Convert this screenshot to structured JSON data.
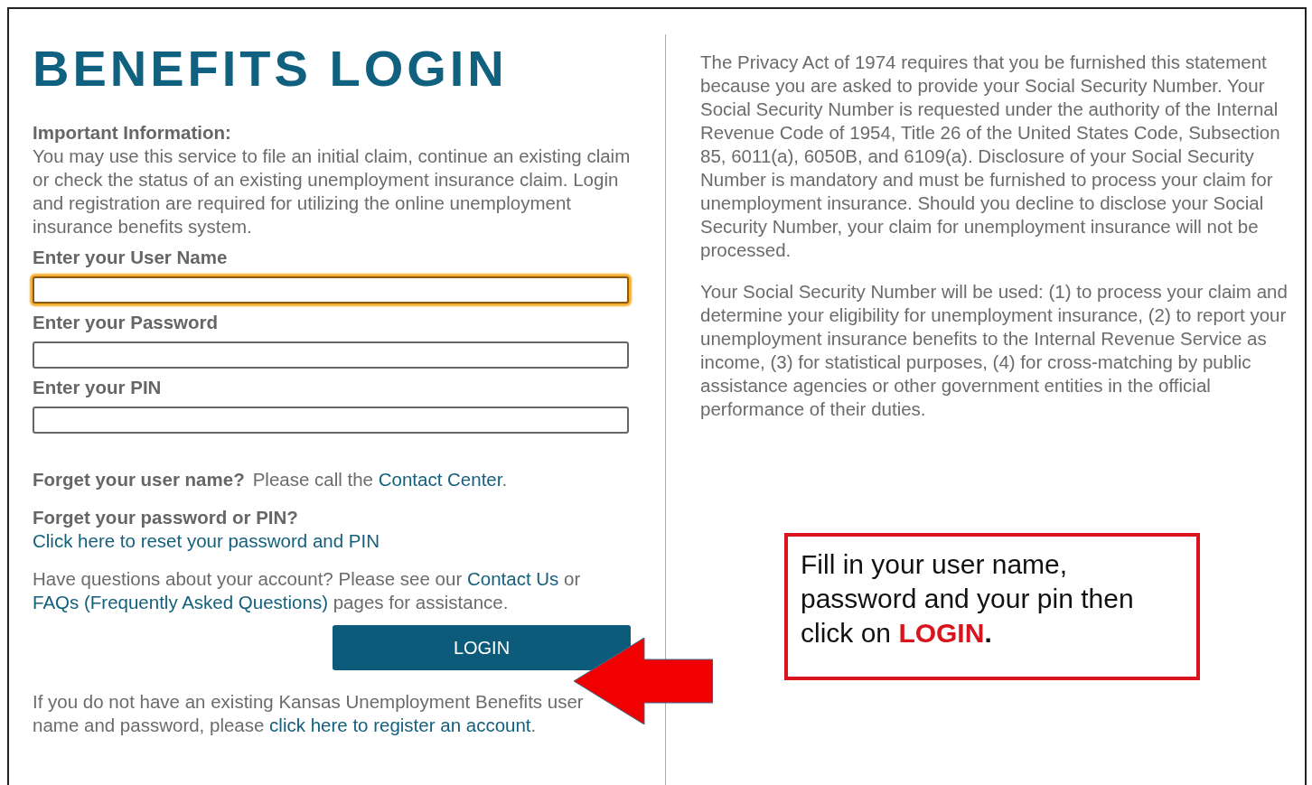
{
  "title": "BENEFITS LOGIN",
  "info": {
    "heading": "Important Information:",
    "text": "You may use this service to file an initial claim, continue an existing claim or check the status of an existing unemployment insurance claim. Login and registration are required for utilizing the online unemployment insurance benefits system."
  },
  "fields": [
    {
      "label": "Enter your User Name",
      "focused": true
    },
    {
      "label": "Enter your Password",
      "focused": false
    },
    {
      "label": "Enter your PIN",
      "focused": false
    }
  ],
  "help": [
    [
      {
        "kind": "bold",
        "text": "Forget your user name?"
      },
      {
        "kind": "plain",
        "text": "Please call the "
      },
      {
        "kind": "link",
        "text": "Contact Center"
      },
      {
        "kind": "plain",
        "text": "."
      }
    ],
    [
      {
        "kind": "bold",
        "text": "Forget your password or PIN?"
      },
      {
        "kind": "link",
        "text": "Click here to reset your password and PIN"
      }
    ],
    [
      {
        "kind": "plain",
        "text": "Have questions about your account? Please see our "
      },
      {
        "kind": "link",
        "text": "Contact Us"
      },
      {
        "kind": "plain",
        "text": " or "
      },
      {
        "kind": "link",
        "text": "FAQs (Frequently Asked Questions)"
      },
      {
        "kind": "plain",
        "text": " pages for assistance."
      }
    ]
  ],
  "login_button": "LOGIN",
  "register": [
    {
      "kind": "plain",
      "text": "If you do not have an existing Kansas Unemployment Benefits user name and password, please "
    },
    {
      "kind": "link",
      "text": "click here to register an account"
    },
    {
      "kind": "plain",
      "text": "."
    }
  ],
  "privacy": [
    "The Privacy Act of 1974 requires that you be furnished this statement because you are asked to provide your Social Security Number. Your Social Security Number is requested under the authority of the Internal Revenue Code of 1954, Title 26 of the United States Code, Subsection 85, 6011(a), 6050B, and 6109(a). Disclosure of your Social Security Number is mandatory and must be furnished to process your claim for unemployment insurance. Should you decline to disclose your Social Security Number, your claim for unemployment insurance will not be processed.",
    "Your Social Security Number will be used: (1) to process your claim and determine your eligibility for unemployment insurance, (2) to report your unemployment insurance benefits to the Internal Revenue Service as income, (3) for statistical purposes, (4) for cross-matching by public assistance agencies or other government entities in the official performance of their duties."
  ],
  "callout": [
    {
      "kind": "plain",
      "text": "Fill in your user name, password and your pin then click on "
    },
    {
      "kind": "emphasis",
      "text": "LOGIN"
    },
    {
      "kind": "bold",
      "text": "."
    }
  ]
}
